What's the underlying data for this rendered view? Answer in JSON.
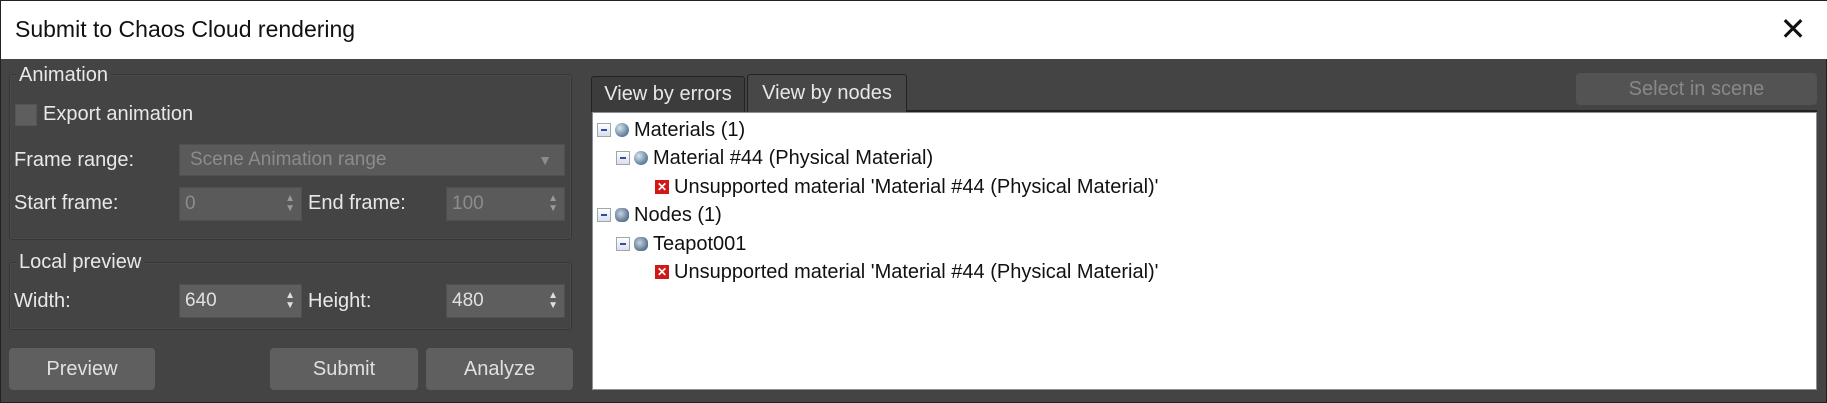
{
  "window": {
    "title": "Submit to Chaos Cloud rendering",
    "close": "✕"
  },
  "animation": {
    "group_label": "Animation",
    "export_label": "Export animation",
    "export_checked": false,
    "frame_range_label": "Frame range:",
    "frame_range_value": "Scene Animation range",
    "start_label": "Start frame:",
    "start_value": "0",
    "end_label": "End frame:",
    "end_value": "100"
  },
  "preview": {
    "group_label": "Local preview",
    "width_label": "Width:",
    "width_value": "640",
    "height_label": "Height:",
    "height_value": "480"
  },
  "buttons": {
    "preview": "Preview",
    "submit": "Submit",
    "analyze": "Analyze",
    "select_in_scene": "Select in scene"
  },
  "tabs": [
    {
      "label": "View by errors"
    },
    {
      "label": "View by nodes"
    }
  ],
  "tree": [
    {
      "label": "Materials (1)",
      "icon": "material-icon"
    },
    {
      "label": "Material #44 (Physical Material)",
      "icon": "material-icon"
    },
    {
      "label": "Unsupported material 'Material #44 (Physical Material)'",
      "icon": "error-icon"
    },
    {
      "label": "Nodes (1)",
      "icon": "node-icon"
    },
    {
      "label": "Teapot001",
      "icon": "node-icon"
    },
    {
      "label": "Unsupported material 'Material #44 (Physical Material)'",
      "icon": "error-icon"
    }
  ],
  "icons": {
    "error": "✕",
    "spinner": "▲▼",
    "dropdown": "▼"
  }
}
